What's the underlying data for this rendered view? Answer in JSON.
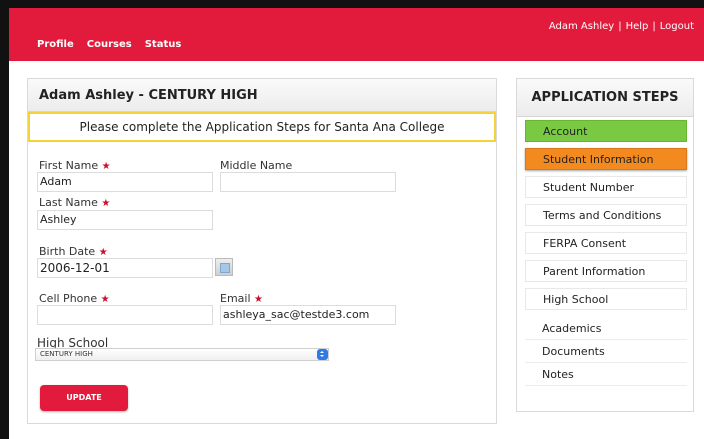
{
  "header": {
    "nav": [
      "Profile",
      "Courses",
      "Status"
    ],
    "user_name": "Adam Ashley",
    "help": "Help",
    "logout": "Logout",
    "separator": "|"
  },
  "panel": {
    "title": "Adam Ashley - CENTURY HIGH",
    "notice": "Please complete the Application Steps for Santa Ana College"
  },
  "form": {
    "first_name_label": "First Name",
    "first_name_value": "Adam",
    "middle_name_label": "Middle Name",
    "middle_name_value": "",
    "last_name_label": "Last Name",
    "last_name_value": "Ashley",
    "birth_date_label": "Birth Date",
    "birth_date_value": "2006-12-01",
    "cell_phone_label": "Cell Phone",
    "cell_phone_value": "",
    "email_label": "Email",
    "email_value": "ashleya_sac@testde3.com",
    "high_school_label": "High School",
    "high_school_value": "CENTURY HIGH",
    "required_mark": "★",
    "update_label": "UPDATE"
  },
  "steps": {
    "title": "APPLICATION STEPS",
    "items": [
      "Account",
      "Student Information",
      "Student Number",
      "Terms and Conditions",
      "FERPA Consent",
      "Parent Information",
      "High School",
      "Academics",
      "Documents",
      "Notes"
    ]
  },
  "colors": {
    "brand_red": "#e21b3c",
    "step_complete": "#7ac943",
    "step_active": "#f28a1f",
    "notice_border": "#f2d33a"
  }
}
